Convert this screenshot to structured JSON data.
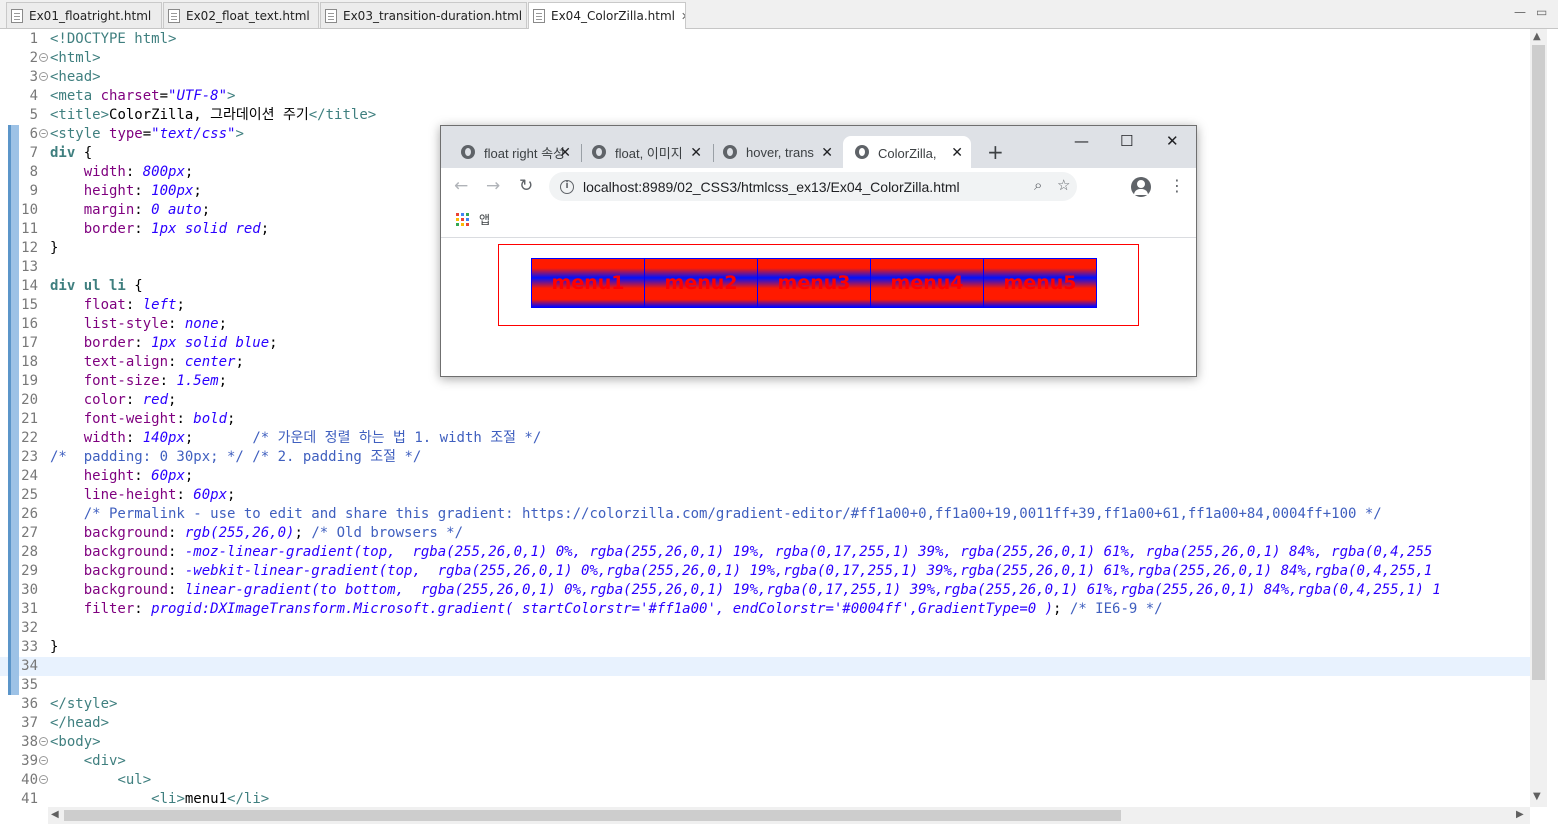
{
  "editor_tabs": [
    {
      "label": "Ex01_floatright.html",
      "active": false
    },
    {
      "label": "Ex02_float_text.html",
      "active": false
    },
    {
      "label": "Ex03_transition-duration.html",
      "active": false
    },
    {
      "label": "Ex04_ColorZilla.html",
      "active": true
    }
  ],
  "editor_window": {
    "minimize": "—",
    "maximize": "▭"
  },
  "code_lines": [
    {
      "n": "1",
      "fold": false,
      "tokens": [
        [
          "tg",
          "<!DOCTYPE html>"
        ]
      ]
    },
    {
      "n": "2",
      "fold": true,
      "tokens": [
        [
          "tg",
          "<html>"
        ]
      ]
    },
    {
      "n": "3",
      "fold": true,
      "tokens": [
        [
          "tg",
          "<head>"
        ]
      ]
    },
    {
      "n": "4",
      "fold": false,
      "tokens": [
        [
          "tg",
          "<meta "
        ],
        [
          "at",
          "charset"
        ],
        [
          "",
          "="
        ],
        [
          "av",
          "\"UTF-8\""
        ],
        [
          "tg",
          ">"
        ]
      ]
    },
    {
      "n": "5",
      "fold": false,
      "tokens": [
        [
          "tg",
          "<title>"
        ],
        [
          "",
          "ColorZilla, 그라데이션 주기"
        ],
        [
          "tg",
          "</title>"
        ]
      ]
    },
    {
      "n": "6",
      "fold": true,
      "tokens": [
        [
          "tg",
          "<style "
        ],
        [
          "at",
          "type"
        ],
        [
          "",
          "="
        ],
        [
          "av",
          "\"text/css\""
        ],
        [
          "tg",
          ">"
        ]
      ]
    },
    {
      "n": "7",
      "fold": false,
      "tokens": [
        [
          "sel",
          "div"
        ],
        [
          "",
          " {"
        ]
      ]
    },
    {
      "n": "8",
      "fold": false,
      "tokens": [
        [
          "",
          "    "
        ],
        [
          "pr",
          "width"
        ],
        [
          "",
          ": "
        ],
        [
          "va",
          "800px"
        ],
        [
          "",
          ";"
        ]
      ]
    },
    {
      "n": "9",
      "fold": false,
      "tokens": [
        [
          "",
          "    "
        ],
        [
          "pr",
          "height"
        ],
        [
          "",
          ": "
        ],
        [
          "va",
          "100px"
        ],
        [
          "",
          ";"
        ]
      ]
    },
    {
      "n": "10",
      "fold": false,
      "tokens": [
        [
          "",
          "    "
        ],
        [
          "pr",
          "margin"
        ],
        [
          "",
          ": "
        ],
        [
          "va",
          "0 auto"
        ],
        [
          "",
          ";"
        ]
      ]
    },
    {
      "n": "11",
      "fold": false,
      "tokens": [
        [
          "",
          "    "
        ],
        [
          "pr",
          "border"
        ],
        [
          "",
          ": "
        ],
        [
          "va",
          "1px solid red"
        ],
        [
          "",
          ";"
        ]
      ]
    },
    {
      "n": "12",
      "fold": false,
      "tokens": [
        [
          "",
          "}"
        ]
      ]
    },
    {
      "n": "13",
      "fold": false,
      "tokens": []
    },
    {
      "n": "14",
      "fold": false,
      "tokens": [
        [
          "sel",
          "div ul li"
        ],
        [
          "",
          " {"
        ]
      ]
    },
    {
      "n": "15",
      "fold": false,
      "tokens": [
        [
          "",
          "    "
        ],
        [
          "pr",
          "float"
        ],
        [
          "",
          ": "
        ],
        [
          "va",
          "left"
        ],
        [
          "",
          ";"
        ]
      ]
    },
    {
      "n": "16",
      "fold": false,
      "tokens": [
        [
          "",
          "    "
        ],
        [
          "pr",
          "list-style"
        ],
        [
          "",
          ": "
        ],
        [
          "va",
          "none"
        ],
        [
          "",
          ";"
        ]
      ]
    },
    {
      "n": "17",
      "fold": false,
      "tokens": [
        [
          "",
          "    "
        ],
        [
          "pr",
          "border"
        ],
        [
          "",
          ": "
        ],
        [
          "va",
          "1px solid blue"
        ],
        [
          "",
          ";"
        ]
      ]
    },
    {
      "n": "18",
      "fold": false,
      "tokens": [
        [
          "",
          "    "
        ],
        [
          "pr",
          "text-align"
        ],
        [
          "",
          ": "
        ],
        [
          "va",
          "center"
        ],
        [
          "",
          ";"
        ]
      ]
    },
    {
      "n": "19",
      "fold": false,
      "tokens": [
        [
          "",
          "    "
        ],
        [
          "pr",
          "font-size"
        ],
        [
          "",
          ": "
        ],
        [
          "va",
          "1.5em"
        ],
        [
          "",
          ";"
        ]
      ]
    },
    {
      "n": "20",
      "fold": false,
      "tokens": [
        [
          "",
          "    "
        ],
        [
          "pr",
          "color"
        ],
        [
          "",
          ": "
        ],
        [
          "va",
          "red"
        ],
        [
          "",
          ";"
        ]
      ]
    },
    {
      "n": "21",
      "fold": false,
      "tokens": [
        [
          "",
          "    "
        ],
        [
          "pr",
          "font-weight"
        ],
        [
          "",
          ": "
        ],
        [
          "va",
          "bold"
        ],
        [
          "",
          ";"
        ]
      ]
    },
    {
      "n": "22",
      "fold": false,
      "tokens": [
        [
          "",
          "    "
        ],
        [
          "pr",
          "width"
        ],
        [
          "",
          ": "
        ],
        [
          "va",
          "140px"
        ],
        [
          "",
          ";       "
        ],
        [
          "cm",
          "/* 가운데 정렬 하는 법 1. width 조절 */"
        ]
      ]
    },
    {
      "n": "23",
      "fold": false,
      "tokens": [
        [
          "cm",
          "/*  padding: 0 30px; */ /* 2. padding 조절 */"
        ]
      ]
    },
    {
      "n": "24",
      "fold": false,
      "tokens": [
        [
          "",
          "    "
        ],
        [
          "pr",
          "height"
        ],
        [
          "",
          ": "
        ],
        [
          "va",
          "60px"
        ],
        [
          "",
          ";"
        ]
      ]
    },
    {
      "n": "25",
      "fold": false,
      "tokens": [
        [
          "",
          "    "
        ],
        [
          "pr",
          "line-height"
        ],
        [
          "",
          ": "
        ],
        [
          "va",
          "60px"
        ],
        [
          "",
          ";"
        ]
      ]
    },
    {
      "n": "26",
      "fold": false,
      "tokens": [
        [
          "",
          "    "
        ],
        [
          "cm",
          "/* Permalink - use to edit and share this gradient: https://colorzilla.com/gradient-editor/#ff1a00+0,ff1a00+19,0011ff+39,ff1a00+61,ff1a00+84,0004ff+100 */"
        ]
      ]
    },
    {
      "n": "27",
      "fold": false,
      "tokens": [
        [
          "",
          "    "
        ],
        [
          "pr",
          "background"
        ],
        [
          "",
          ": "
        ],
        [
          "va",
          "rgb(255,26,0)"
        ],
        [
          "",
          "; "
        ],
        [
          "cm",
          "/* Old browsers */"
        ]
      ]
    },
    {
      "n": "28",
      "fold": false,
      "tokens": [
        [
          "",
          "    "
        ],
        [
          "pr",
          "background"
        ],
        [
          "",
          ": "
        ],
        [
          "va",
          "-moz-linear-gradient(top,  rgba(255,26,0,1) 0%, rgba(255,26,0,1) 19%, rgba(0,17,255,1) 39%, rgba(255,26,0,1) 61%, rgba(255,26,0,1) 84%, rgba(0,4,255"
        ]
      ]
    },
    {
      "n": "29",
      "fold": false,
      "tokens": [
        [
          "",
          "    "
        ],
        [
          "pr",
          "background"
        ],
        [
          "",
          ": "
        ],
        [
          "va",
          "-webkit-linear-gradient(top,  rgba(255,26,0,1) 0%,rgba(255,26,0,1) 19%,rgba(0,17,255,1) 39%,rgba(255,26,0,1) 61%,rgba(255,26,0,1) 84%,rgba(0,4,255,1"
        ]
      ]
    },
    {
      "n": "30",
      "fold": false,
      "tokens": [
        [
          "",
          "    "
        ],
        [
          "pr",
          "background"
        ],
        [
          "",
          ": "
        ],
        [
          "va",
          "linear-gradient(to bottom,  rgba(255,26,0,1) 0%,rgba(255,26,0,1) 19%,rgba(0,17,255,1) 39%,rgba(255,26,0,1) 61%,rgba(255,26,0,1) 84%,rgba(0,4,255,1) 1"
        ]
      ]
    },
    {
      "n": "31",
      "fold": false,
      "tokens": [
        [
          "",
          "    "
        ],
        [
          "pr",
          "filter"
        ],
        [
          "",
          ": "
        ],
        [
          "va",
          "progid:DXImageTransform.Microsoft.gradient( startColorstr='#ff1a00', endColorstr='#0004ff',GradientType=0 )"
        ],
        [
          "",
          "; "
        ],
        [
          "cm",
          "/* IE6-9 */"
        ]
      ]
    },
    {
      "n": "32",
      "fold": false,
      "tokens": []
    },
    {
      "n": "33",
      "fold": false,
      "tokens": [
        [
          "",
          "}"
        ]
      ]
    },
    {
      "n": "34",
      "fold": false,
      "tokens": [],
      "current": true
    },
    {
      "n": "35",
      "fold": false,
      "tokens": []
    },
    {
      "n": "36",
      "fold": false,
      "tokens": [
        [
          "tg",
          "</style>"
        ]
      ]
    },
    {
      "n": "37",
      "fold": false,
      "tokens": [
        [
          "tg",
          "</head>"
        ]
      ]
    },
    {
      "n": "38",
      "fold": true,
      "tokens": [
        [
          "tg",
          "<body>"
        ]
      ]
    },
    {
      "n": "39",
      "fold": true,
      "tokens": [
        [
          "",
          "    "
        ],
        [
          "tg",
          "<div>"
        ]
      ]
    },
    {
      "n": "40",
      "fold": true,
      "tokens": [
        [
          "",
          "        "
        ],
        [
          "tg",
          "<ul>"
        ]
      ]
    },
    {
      "n": "41",
      "fold": false,
      "tokens": [
        [
          "",
          "            "
        ],
        [
          "tg",
          "<li>"
        ],
        [
          "",
          "menu1"
        ],
        [
          "tg",
          "</li>"
        ]
      ]
    }
  ],
  "browser": {
    "tabs": [
      {
        "title": "float right 속성",
        "active": false
      },
      {
        "title": "float, 이미지",
        "active": false
      },
      {
        "title": "hover, transition",
        "active": false
      },
      {
        "title": "ColorZilla, 그라데이션",
        "active": true
      }
    ],
    "new_tab": "+",
    "window_buttons": {
      "minimize": "—",
      "maximize": "☐",
      "close": "✕"
    },
    "url": "localhost:8989/02_CSS3/htmlcss_ex13/Ex04_ColorZilla.html",
    "apps_label": "앱",
    "menu_items": [
      "menu1",
      "menu2",
      "menu3",
      "menu4",
      "menu5"
    ]
  },
  "colors": {
    "gradient_red": "#ff1a00",
    "gradient_blue": "#0011ff",
    "gradient_end": "#0004ff"
  }
}
